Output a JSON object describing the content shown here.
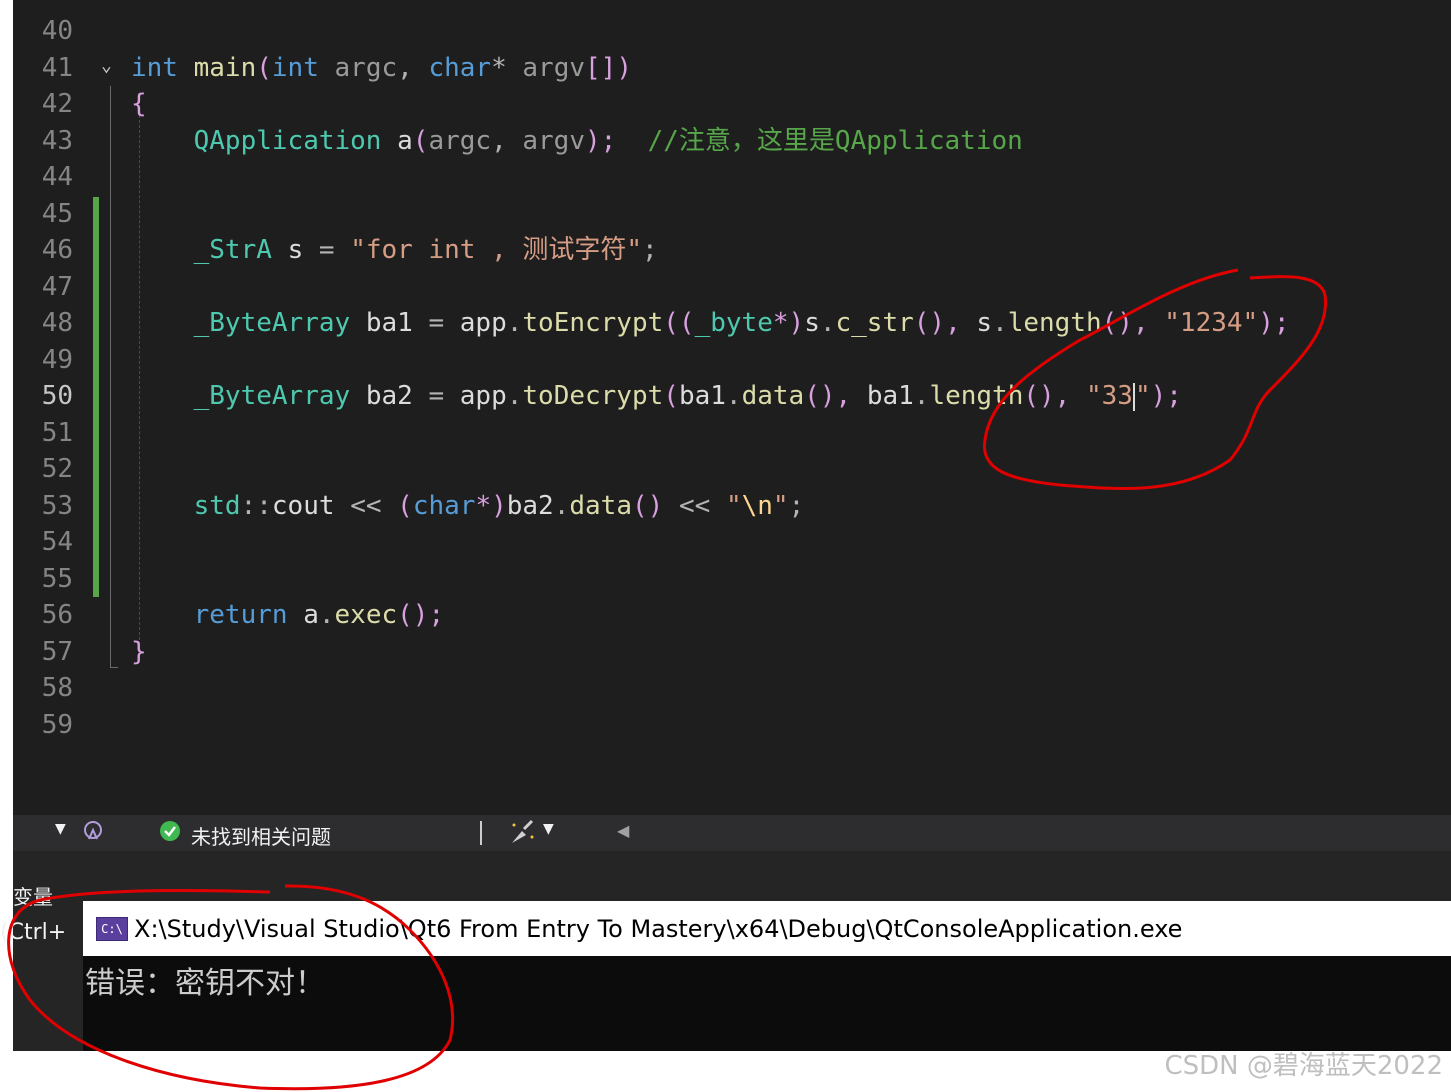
{
  "editor": {
    "line_numbers": [
      "40",
      "41",
      "42",
      "43",
      "44",
      "45",
      "46",
      "47",
      "48",
      "49",
      "50",
      "51",
      "52",
      "53",
      "54",
      "55",
      "56",
      "57",
      "58",
      "59"
    ],
    "active_line": "50",
    "lines": {
      "l41": {
        "kw_int": "int",
        "fn_main": "main",
        "p1": "(",
        "kw_int2": "int",
        "argc": "argc",
        ",1": ",",
        "kw_char": "char",
        "star": "*",
        "argv": "argv",
        "br": "[])"
      },
      "l42": {
        "brace": "{"
      },
      "l43": {
        "cls": "QApplication",
        "a": "a",
        "paren": "(",
        "argc": "argc",
        "comma": ",",
        "argv": "argv",
        "end": ");",
        "comment": "//注意，这里是QApplication"
      },
      "l46": {
        "type": "_StrA",
        "var": "s",
        "eq": "=",
        "str": "\"for int , 测试字符\"",
        "semi": ";"
      },
      "l48": {
        "type": "_ByteArray",
        "var": "ba1",
        "eq": "=",
        "obj": "app",
        "dot": ".",
        "method": "toEncrypt",
        "open": "((",
        "castType": "_byte",
        "star": "*)",
        "s": "s",
        "dot2": ".",
        "cstr": "c_str",
        "p": "(),",
        "s2": "s",
        "dot3": ".",
        "len": "length",
        "p2": "(),",
        "str": "\"1234\"",
        "end": ");"
      },
      "l50": {
        "type": "_ByteArray",
        "var": "ba2",
        "eq": "=",
        "obj": "app",
        "dot": ".",
        "method": "toDecrypt",
        "open": "(",
        "ba1": "ba1",
        "dot2": ".",
        "data": "data",
        "p": "(),",
        "ba1b": "ba1",
        "dot3": ".",
        "len": "length",
        "p2": "(),",
        "str_a": "\"33",
        "str_b": "\"",
        "end": ");"
      },
      "l53": {
        "ns": "std",
        "sep": "::",
        "cout": "cout",
        "op": "<<",
        "open": "(",
        "kw_char": "char",
        "star": "*)",
        "ba2": "ba2",
        "dot": ".",
        "data": "data",
        "p": "()",
        "op2": "<<",
        "q1": "\"",
        "esc": "\\n",
        "q2": "\"",
        "semi": ";"
      },
      "l56": {
        "kw": "return",
        "a": "a",
        "dot": ".",
        "exec": "exec",
        "end": "();"
      },
      "l57": {
        "brace": "}"
      }
    }
  },
  "status_bar": {
    "issues_text": "未找到相关问题"
  },
  "panel": {
    "title": "变量",
    "search_hint": "(Ctrl+"
  },
  "console": {
    "icon_label": "C:\\",
    "title": "X:\\Study\\Visual Studio\\Qt6 From Entry To Mastery\\x64\\Debug\\QtConsoleApplication.exe",
    "output": "错误：密钥不对！"
  },
  "watermark": "CSDN @碧海蓝天2022",
  "colors": {
    "editor_bg": "#1e1e1e",
    "change_bar": "#57a64a",
    "annotation": "#e00000"
  }
}
